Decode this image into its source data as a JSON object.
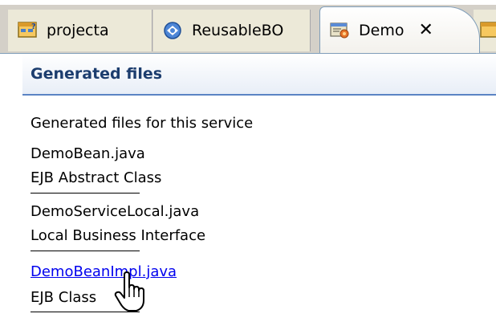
{
  "tabs": [
    {
      "label": "projecta",
      "icon": "project-icon",
      "active": false
    },
    {
      "label": "ReusableBO",
      "icon": "globe-icon",
      "active": false
    },
    {
      "label": "Demo",
      "icon": "editor-icon",
      "active": true,
      "close": "✕"
    }
  ],
  "section": {
    "title": "Generated files",
    "description": "Generated files for this service"
  },
  "files": [
    {
      "name": "DemoBean.java",
      "type": "EJB Abstract Class",
      "is_link": false
    },
    {
      "name": "DemoServiceLocal.java",
      "type": "Local Business Interface",
      "is_link": false
    },
    {
      "name": "DemoBeanImpl.java",
      "type": "EJB Class",
      "is_link": true
    }
  ],
  "colors": {
    "header_text": "#1c3d6e",
    "header_rule": "#5b84c4",
    "link": "#0000ee",
    "tab_bg": "#ece9d8"
  }
}
